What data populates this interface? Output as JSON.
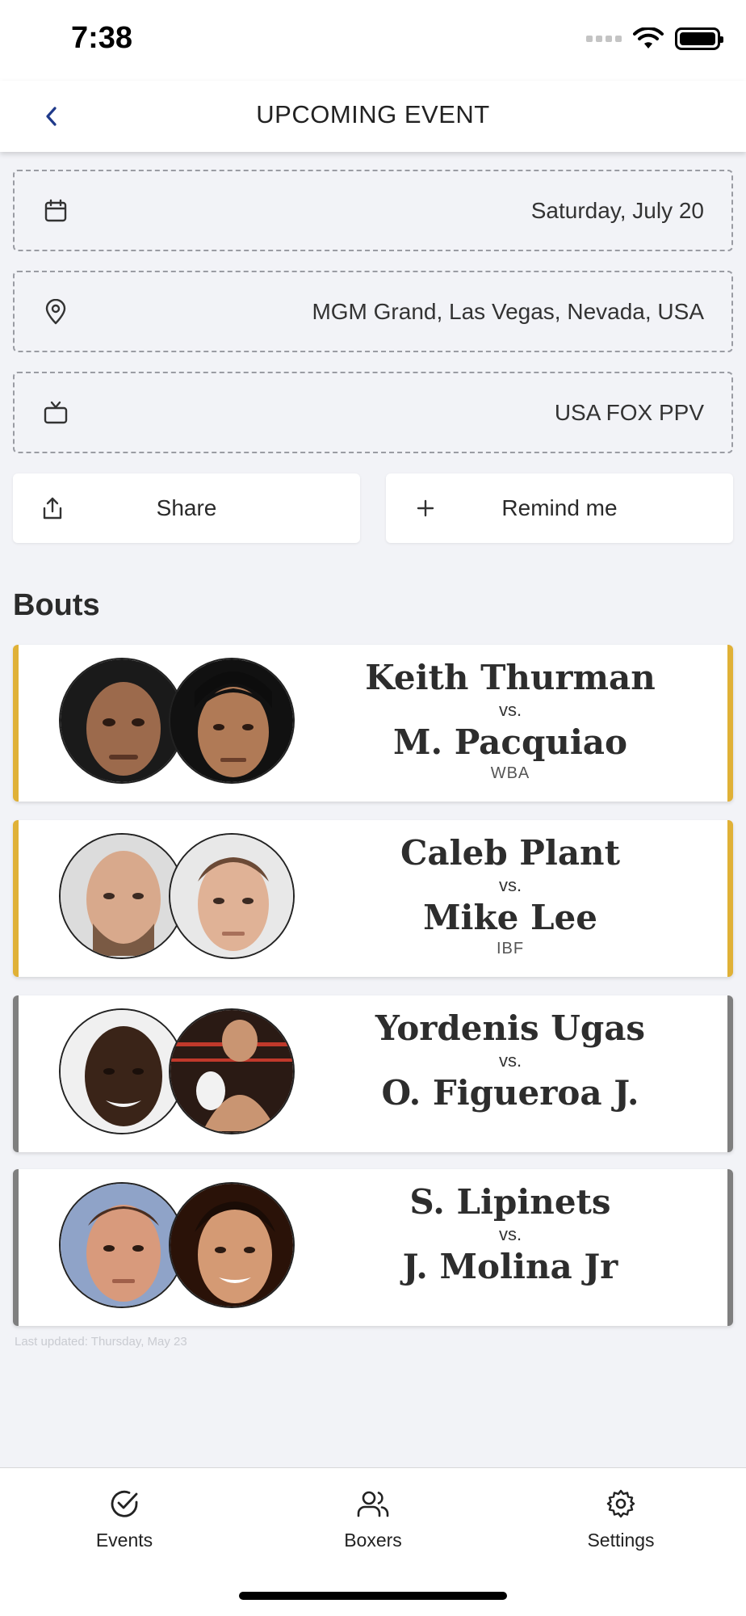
{
  "status_bar": {
    "time": "7:38"
  },
  "nav": {
    "title": "UPCOMING EVENT"
  },
  "event": {
    "date": "Saturday, July 20",
    "venue": "MGM Grand, Las Vegas, Nevada, USA",
    "broadcast": "USA FOX PPV"
  },
  "actions": {
    "share_label": "Share",
    "remind_label": "Remind me"
  },
  "bouts_title": "Bouts",
  "bouts": [
    {
      "fighter1": "Keith Thurman",
      "vs": "vs.",
      "fighter2": "M. Pacquiao",
      "title": "WBA",
      "accent": "#e0b137"
    },
    {
      "fighter1": "Caleb Plant",
      "vs": "vs.",
      "fighter2": "Mike Lee",
      "title": "IBF",
      "accent": "#e0b137"
    },
    {
      "fighter1": "Yordenis Ugas",
      "vs": "vs.",
      "fighter2": "O. Figueroa J.",
      "title": "",
      "accent": "#7f7f7f"
    },
    {
      "fighter1": "S. Lipinets",
      "vs": "vs.",
      "fighter2": "J. Molina Jr",
      "title": "",
      "accent": "#7f7f7f"
    }
  ],
  "last_updated": "Last updated: Thursday, May 23",
  "tabs": [
    {
      "label": "Events",
      "icon": "check-circle-icon"
    },
    {
      "label": "Boxers",
      "icon": "users-icon"
    },
    {
      "label": "Settings",
      "icon": "gear-icon"
    }
  ]
}
